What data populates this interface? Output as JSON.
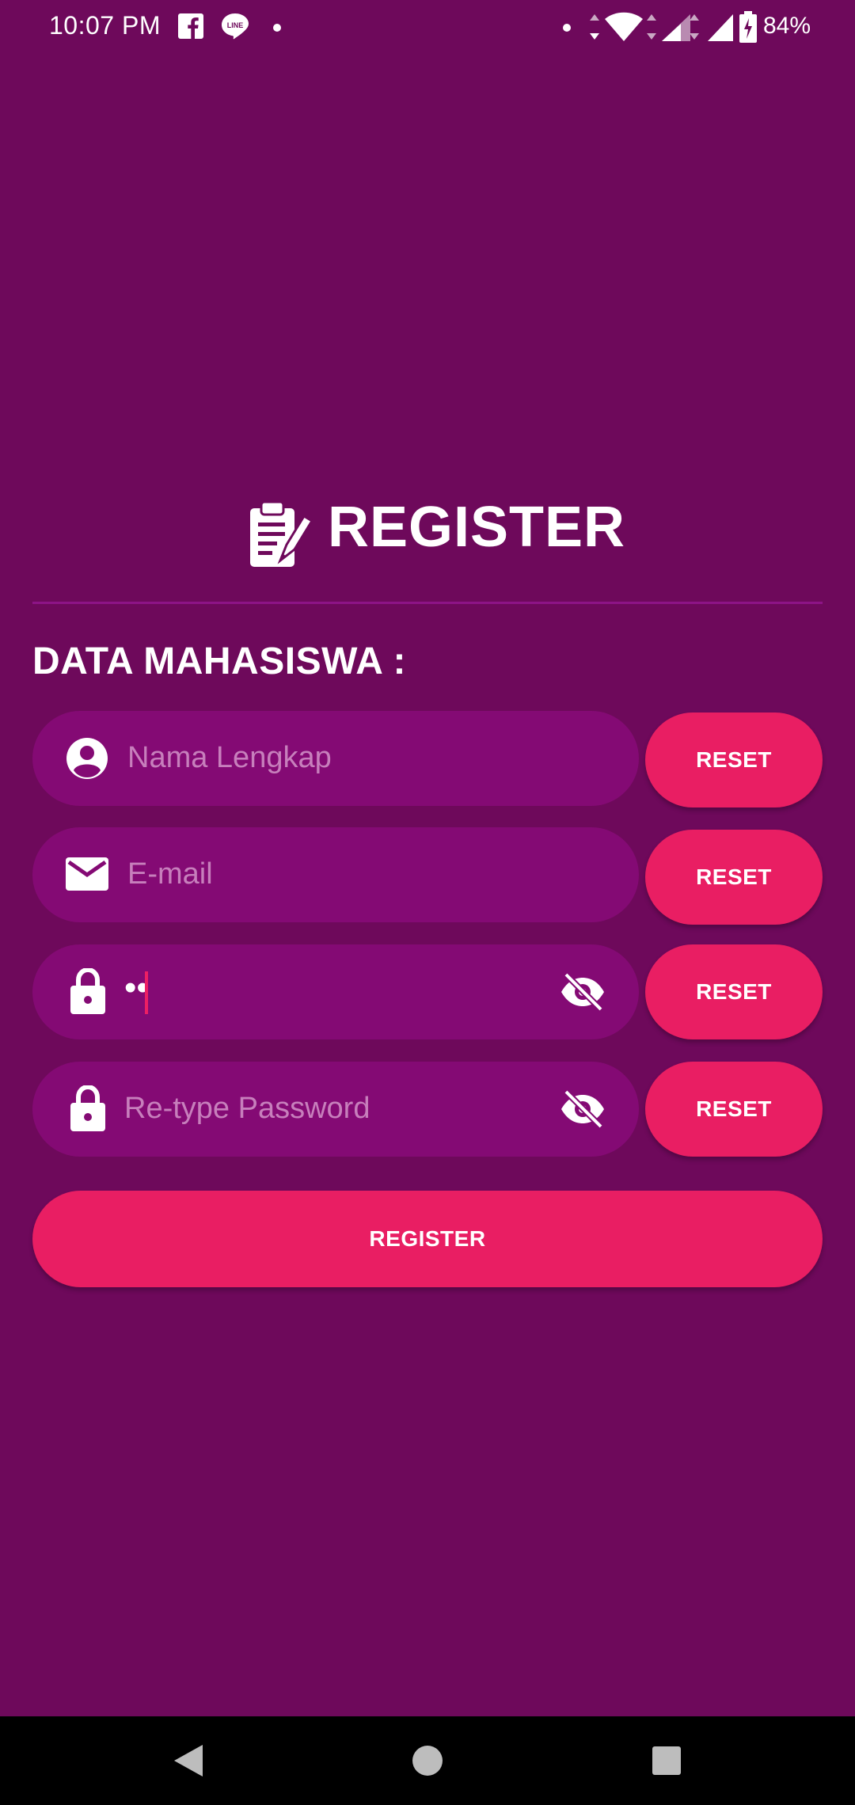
{
  "status_bar": {
    "time": "10:07 PM",
    "battery": "84%",
    "icons": [
      "facebook-icon",
      "line-icon",
      "dot-icon",
      "wifi-icon",
      "signal-icon",
      "battery-icon"
    ]
  },
  "header": {
    "title": "REGISTER",
    "icon": "clipboard-edit-icon"
  },
  "form": {
    "section_label": "DATA MAHASISWA :",
    "fields": [
      {
        "placeholder": "Nama Lengkap",
        "value": "",
        "icon": "account-circle-icon"
      },
      {
        "placeholder": "E-mail",
        "value": "",
        "icon": "email-icon"
      },
      {
        "placeholder": "",
        "value": "••",
        "icon": "lock-icon",
        "toggle": "eye-off-icon"
      },
      {
        "placeholder": "Re-type Password",
        "value": "",
        "icon": "lock-icon",
        "toggle": "eye-off-icon"
      }
    ],
    "reset_label": "RESET",
    "register_label": "REGISTER"
  },
  "nav": {
    "buttons": [
      "back-icon",
      "home-icon",
      "recents-icon"
    ]
  },
  "colors": {
    "background": "#6e095b",
    "field": "#840a74",
    "accent": "#e91e63",
    "placeholder": "#c77fbc"
  }
}
